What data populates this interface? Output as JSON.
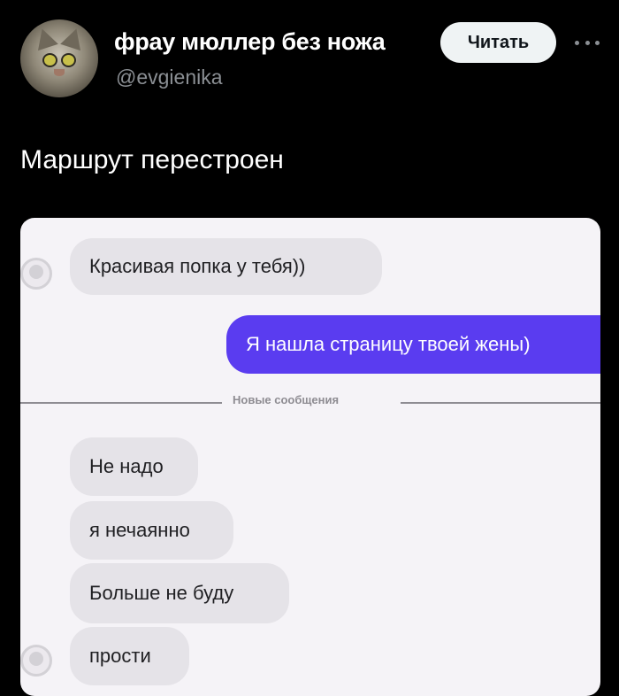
{
  "tweet": {
    "display_name": "фрау мюллер без ножа",
    "handle": "@evgienika",
    "follow_label": "Читать",
    "more_icon": "more-horizontal-icon",
    "text": "Маршрут перестроен"
  },
  "chat": {
    "divider_label": "Новые сообщения",
    "messages": [
      {
        "direction": "incoming",
        "text": "Красивая попка у тебя))"
      },
      {
        "direction": "outgoing",
        "text": "Я нашла страницу твоей жены)"
      },
      {
        "direction": "incoming",
        "text": "Не надо"
      },
      {
        "direction": "incoming",
        "text": "я нечаянно"
      },
      {
        "direction": "incoming",
        "text": "Больше не буду"
      },
      {
        "direction": "incoming",
        "text": "прости"
      }
    ]
  },
  "colors": {
    "background": "#000000",
    "follow_button_bg": "#eff3f4",
    "outgoing_bubble": "#5a3cf0",
    "incoming_bubble": "#e5e3e8"
  }
}
